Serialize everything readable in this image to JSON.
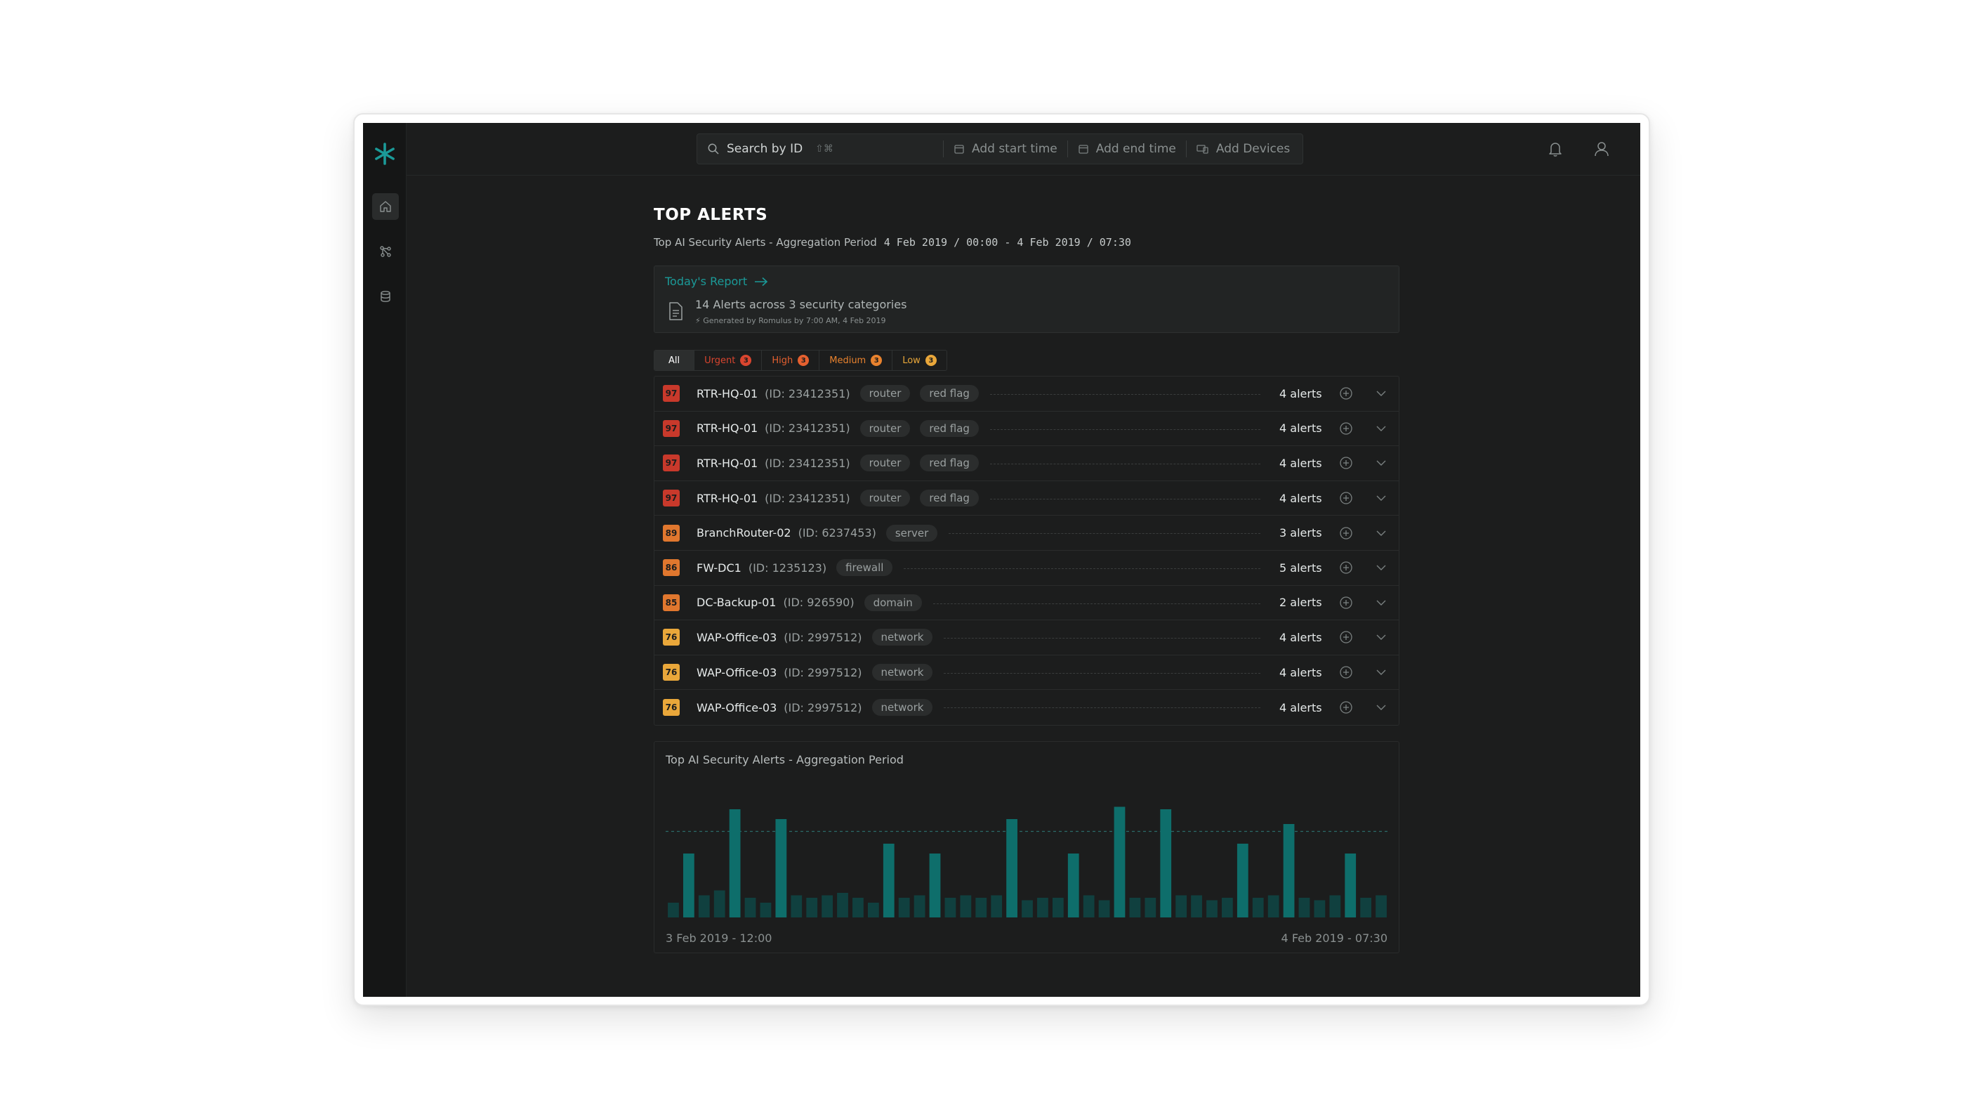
{
  "search": {
    "placeholder": "Search by ID",
    "shortcut": "⇧⌘",
    "start": "Add start time",
    "end": "Add end time",
    "devices": "Add Devices"
  },
  "page": {
    "title": "TOP ALERTS",
    "subtitle": "Top AI Security Alerts - Aggregation Period",
    "period": "4 Feb 2019 / 00:00 - 4 Feb 2019 / 07:30"
  },
  "report": {
    "link": "Today's Report",
    "summary": "14 Alerts across 3 security categories",
    "generated": "Generated by Romulus by 7:00 AM, 4 Feb 2019"
  },
  "filters": [
    {
      "label": "All",
      "count": null,
      "color": "#ffffff"
    },
    {
      "label": "Urgent",
      "count": "3",
      "color": "#d9452f"
    },
    {
      "label": "High",
      "count": "3",
      "color": "#e5602f"
    },
    {
      "label": "Medium",
      "count": "3",
      "color": "#e8822e"
    },
    {
      "label": "Low",
      "count": "3",
      "color": "#e9a73a"
    }
  ],
  "alerts": [
    {
      "score": "97",
      "name": "RTR-HQ-01",
      "id": "(ID: 23412351)",
      "tags": [
        "router",
        "red flag"
      ],
      "count": "4 alerts",
      "color": "#c8392b"
    },
    {
      "score": "97",
      "name": "RTR-HQ-01",
      "id": "(ID: 23412351)",
      "tags": [
        "router",
        "red flag"
      ],
      "count": "4 alerts",
      "color": "#c8392b"
    },
    {
      "score": "97",
      "name": "RTR-HQ-01",
      "id": "(ID: 23412351)",
      "tags": [
        "router",
        "red flag"
      ],
      "count": "4 alerts",
      "color": "#c8392b"
    },
    {
      "score": "97",
      "name": "RTR-HQ-01",
      "id": "(ID: 23412351)",
      "tags": [
        "router",
        "red flag"
      ],
      "count": "4 alerts",
      "color": "#c8392b"
    },
    {
      "score": "89",
      "name": "BranchRouter-02",
      "id": "(ID: 6237453)",
      "tags": [
        "server"
      ],
      "count": "3 alerts",
      "color": "#e0772e"
    },
    {
      "score": "86",
      "name": "FW-DC1",
      "id": "(ID: 1235123)",
      "tags": [
        "firewall"
      ],
      "count": "5 alerts",
      "color": "#e0772e"
    },
    {
      "score": "85",
      "name": "DC-Backup-01",
      "id": "(ID: 926590)",
      "tags": [
        "domain"
      ],
      "count": "2 alerts",
      "color": "#e0772e"
    },
    {
      "score": "76",
      "name": "WAP-Office-03",
      "id": "(ID: 2997512)",
      "tags": [
        "network"
      ],
      "count": "4 alerts",
      "color": "#e9a73a"
    },
    {
      "score": "76",
      "name": "WAP-Office-03",
      "id": "(ID: 2997512)",
      "tags": [
        "network"
      ],
      "count": "4 alerts",
      "color": "#e9a73a"
    },
    {
      "score": "76",
      "name": "WAP-Office-03",
      "id": "(ID: 2997512)",
      "tags": [
        "network"
      ],
      "count": "4 alerts",
      "color": "#e9a73a"
    }
  ],
  "chart_data": {
    "type": "bar",
    "title": "Top AI Security Alerts - Aggregation Period",
    "x_start_label": "3 Feb 2019 - 12:00",
    "x_end_label": "4 Feb 2019 - 07:30",
    "threshold": 70,
    "values": [
      12,
      52,
      18,
      22,
      88,
      16,
      12,
      80,
      18,
      16,
      18,
      20,
      16,
      12,
      60,
      16,
      18,
      52,
      16,
      18,
      16,
      18,
      80,
      14,
      16,
      16,
      52,
      18,
      14,
      90,
      16,
      16,
      88,
      18,
      18,
      14,
      16,
      60,
      16,
      18,
      76,
      16,
      14,
      18,
      52,
      16,
      18
    ],
    "highlight_color": "#0e6e6b",
    "base_color": "#10403f",
    "grid": false
  }
}
